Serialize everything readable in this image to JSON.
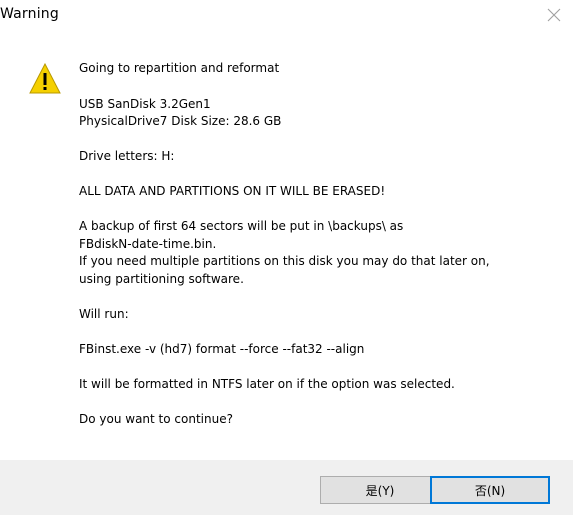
{
  "window": {
    "title": "Warning",
    "close_icon": "close-icon"
  },
  "icon": {
    "name": "warning-icon",
    "color": "#f5d000",
    "glyph": "!"
  },
  "message": {
    "line1": "Going to repartition and reformat",
    "device": " USB  SanDisk 3.2Gen1\nPhysicalDrive7   Disk Size: 28.6 GB",
    "letters": "Drive letters:  H:",
    "erase": "ALL DATA AND PARTITIONS ON IT WILL BE ERASED!",
    "backup": "A backup of first 64 sectors will be put in \\backups\\ as\nFBdiskN-date-time.bin.\nIf you need multiple partitions on this disk you may do that later on,\nusing partitioning software.",
    "will_run": "Will run:",
    "command": "FBinst.exe -v (hd7) format --force  --fat32 --align",
    "ntfs": "It will be formatted in NTFS later on if the option was selected.",
    "question": "Do you want to continue?"
  },
  "buttons": {
    "yes": "是(Y)",
    "no": "否(N)"
  }
}
